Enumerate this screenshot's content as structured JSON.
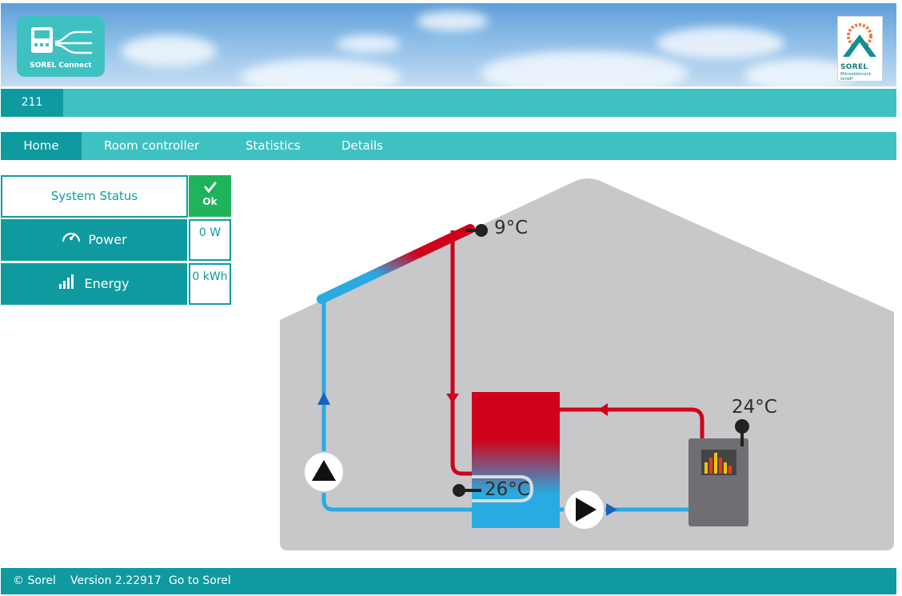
{
  "header": {
    "left_logo": {
      "label": "SOREL Connect"
    },
    "right_logo": {
      "brand": "SOREL",
      "sub": "Mikroelektronik GmbH"
    }
  },
  "device": {
    "id": "211"
  },
  "nav": {
    "tabs": [
      {
        "label": "Home",
        "active": true
      },
      {
        "label": "Room controller",
        "active": false
      },
      {
        "label": "Statistics",
        "active": false
      },
      {
        "label": "Details",
        "active": false
      }
    ]
  },
  "status": {
    "system_status_label": "System Status",
    "system_status_value": "Ok",
    "power_label": "Power",
    "power_value": "0 W",
    "energy_label": "Energy",
    "energy_value": "0 kWh"
  },
  "diagram": {
    "collector_temp": "9°C",
    "boiler_temp": "24°C",
    "tank_temp": "26°C"
  },
  "footer": {
    "copyright": "© Sorel",
    "version": "Version 2.22917",
    "link": "Go to Sorel"
  },
  "colors": {
    "teal_light": "#3fc1c2",
    "teal_dark": "#0f9aa0",
    "ok_green": "#1fb35b",
    "hot_red": "#d0021b",
    "cold_blue": "#29abe2",
    "house_grey": "#c8c8ca"
  }
}
